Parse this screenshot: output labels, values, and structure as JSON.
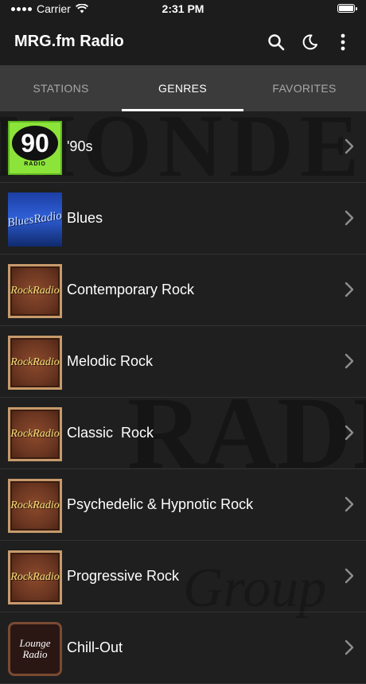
{
  "status_bar": {
    "carrier": "Carrier",
    "time": "2:31 PM",
    "battery_level": 1.0
  },
  "app_bar": {
    "title": "MRG.fm Radio",
    "actions": [
      "search-icon",
      "moon-icon",
      "more-vertical-icon"
    ]
  },
  "tabs": [
    {
      "label": "STATIONS",
      "active": false
    },
    {
      "label": "GENRES",
      "active": true
    },
    {
      "label": "FAVORITES",
      "active": false
    }
  ],
  "genres": [
    {
      "label": "'90s",
      "logo": "90s-radio-logo",
      "logo_text": "90",
      "logo_subtext": "RADIO"
    },
    {
      "label": "Blues",
      "logo": "blues-radio-logo",
      "logo_text": "BluesRadio"
    },
    {
      "label": "Contemporary Rock",
      "logo": "rock-radio-logo",
      "logo_text": "RockRadio"
    },
    {
      "label": "Melodic Rock",
      "logo": "rock-radio-logo",
      "logo_text": "RockRadio"
    },
    {
      "label": "Classic  Rock",
      "logo": "rock-radio-logo",
      "logo_text": "RockRadio"
    },
    {
      "label": "Psychedelic & Hypnotic Rock",
      "logo": "rock-radio-logo",
      "logo_text": "RockRadio"
    },
    {
      "label": "Progressive Rock",
      "logo": "rock-radio-logo",
      "logo_text": "RockRadio"
    },
    {
      "label": "Chill-Out",
      "logo": "lounge-radio-logo",
      "logo_text_line1": "Lounge",
      "logo_text_line2": "Radio"
    }
  ],
  "background": {
    "watermark_line1": "MONDELLO",
    "watermark_line2": "RADIO",
    "watermark_line3": "Group"
  },
  "colors": {
    "app_bar": "#1c1c1c",
    "tab_bar": "#3b3b3b",
    "list_background": "#1f1f1f",
    "active_tab": "#ffffff",
    "inactive_tab": "#a7a7a7"
  }
}
